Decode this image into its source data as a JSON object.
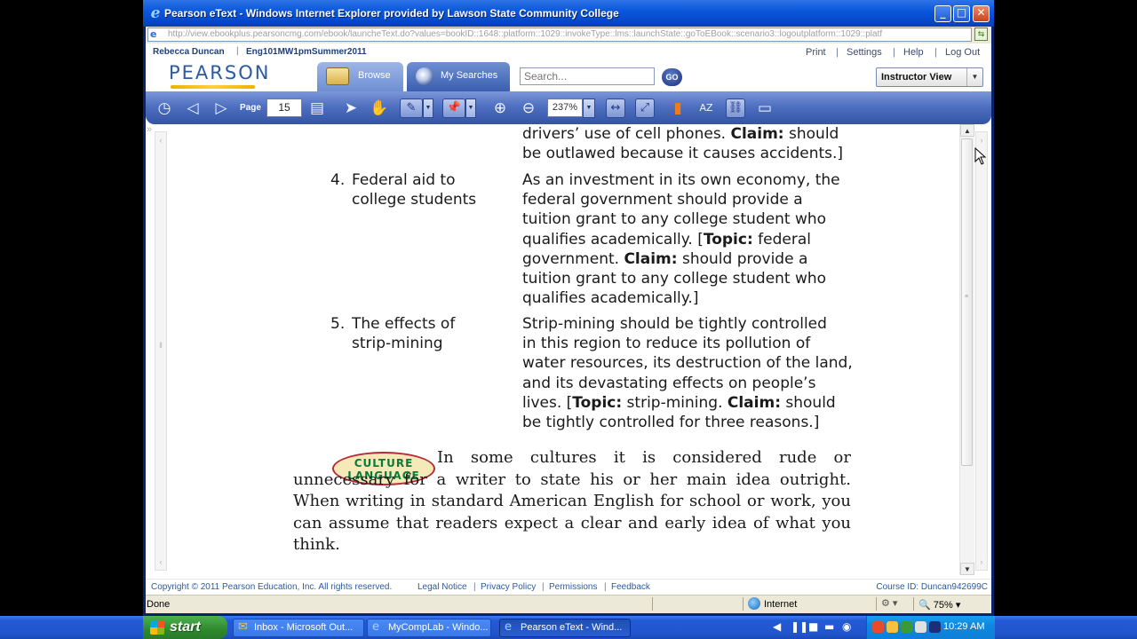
{
  "window": {
    "title": "Pearson eText - Windows Internet Explorer provided by Lawson State Community College",
    "minimize": "_",
    "maximize": "□",
    "close": "✕"
  },
  "address_bar": {
    "url": "http://view.ebookplus.pearsoncmg.com/ebook/launcheText.do?values=bookID::1648::platform::1029::invokeType::lms::launchState::goToEBook::scenario3::logoutplatform::1029::platf"
  },
  "user_bar": {
    "user": "Rebecca Duncan",
    "separator": "|",
    "course": "Eng101MW1pmSummer2011",
    "links": [
      "Print",
      "Settings",
      "Help",
      "Log Out"
    ]
  },
  "brand": {
    "logo": "PEARSON",
    "tabs": [
      "Browse",
      "My Searches"
    ],
    "search_placeholder": "Search...",
    "go": "GO",
    "view_select": "Instructor View"
  },
  "toolbar": {
    "page_label": "Page",
    "page_value": "15",
    "zoom_value": "237%"
  },
  "content": {
    "fragment_lines": [
      "drivers’ use of cell phones. <b>Claim:</b> should",
      "be outlawed because it causes accidents.]"
    ],
    "items": [
      {
        "number": "4.",
        "topic": "Federal aid to\ncollege students",
        "thesis_lines": [
          "As an investment in its own economy, the",
          "federal government should provide a",
          "tuition grant to any college student who",
          "qualifies academically. [<b>Topic:</b> federal",
          "government. <b>Claim:</b> should provide a",
          "tuition grant to any college student who",
          "qualifies academically.]"
        ]
      },
      {
        "number": "5.",
        "topic": "The effects of\nstrip-mining",
        "thesis_lines": [
          "Strip-mining should be tightly controlled",
          "in this region to reduce its pollution of",
          "water resources, its destruction of the land,",
          "and its devastating effects on people’s",
          "lives. [<b>Topic:</b> strip-mining. <b>Claim:</b> should",
          "be tightly controlled for three reasons.]"
        ]
      }
    ],
    "culture_badge": [
      "CULTURE",
      "LANGUAGE"
    ],
    "culture_text": "In some cultures it is considered rude or unnecessary for a writer to state his or her main idea outright. When writing in standard American English for school or work, you can assume that readers expect a clear and early idea of what you think."
  },
  "footer": {
    "copyright": "Copyright © 2011 Pearson Education, Inc. All rights reserved.",
    "links": [
      "Legal Notice",
      "Privacy Policy",
      "Permissions",
      "Feedback"
    ],
    "course_id": "Course ID: Duncan942699C"
  },
  "status_bar": {
    "status": "Done",
    "zone": "Internet",
    "zoom": "75%"
  },
  "taskbar": {
    "start": "start",
    "tasks": [
      "Inbox - Microsoft Out...",
      "MyCompLab - Windo...",
      "Pearson eText - Wind..."
    ],
    "clock": "10:29 AM"
  },
  "colors": {
    "titlebar": "#0a58dd",
    "pearson_blue": "#2b5aa0",
    "toolbar": "#4f6fc0",
    "taskbar": "#2459d6"
  },
  "icons": {
    "toolbar": [
      "home-icon",
      "back-arrow-icon",
      "forward-arrow-icon",
      "book-icon",
      "select-pointer-icon",
      "pan-hand-icon",
      "highlighter-icon",
      "note-pin-icon",
      "zoom-in-icon",
      "zoom-out-icon",
      "fit-width-icon",
      "fit-page-icon",
      "bookmark-icon",
      "glossary-icon",
      "link-icon",
      "media-icon"
    ]
  }
}
